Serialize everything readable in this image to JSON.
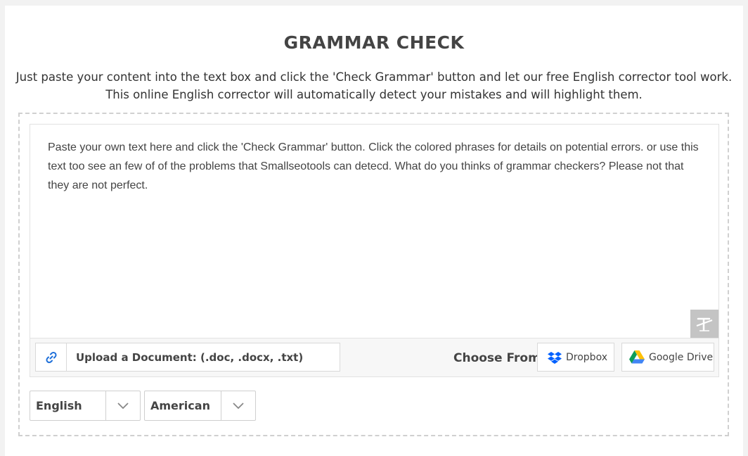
{
  "header": {
    "title": "GRAMMAR CHECK",
    "description_line1": "Just paste your content into the text box and click the 'Check Grammar' button and let our free English corrector tool work.",
    "description_line2": "This online English corrector will automatically detect your mistakes and will highlight them."
  },
  "editor": {
    "text": "Paste your own text here and click the 'Check Grammar' button. Click the colored phrases for details on potential errors. or use this text too see an few of of the problems that Smallseotools can detecd. What do you thinks of grammar checkers? Please not that they are not perfect.",
    "clear_icon": "clear-text-icon"
  },
  "toolbar": {
    "upload_label": "Upload a Document: (.doc, .docx, .txt)",
    "upload_icon": "link-icon",
    "choose_from_label": "Choose From:",
    "dropbox_label": "Dropbox",
    "google_drive_label": "Google Drive"
  },
  "options": {
    "language": "English",
    "variant": "American"
  },
  "colors": {
    "accent_blue": "#1e6fd9",
    "dropbox_blue": "#0061ff",
    "clear_button_bg": "#c4c4c4"
  }
}
